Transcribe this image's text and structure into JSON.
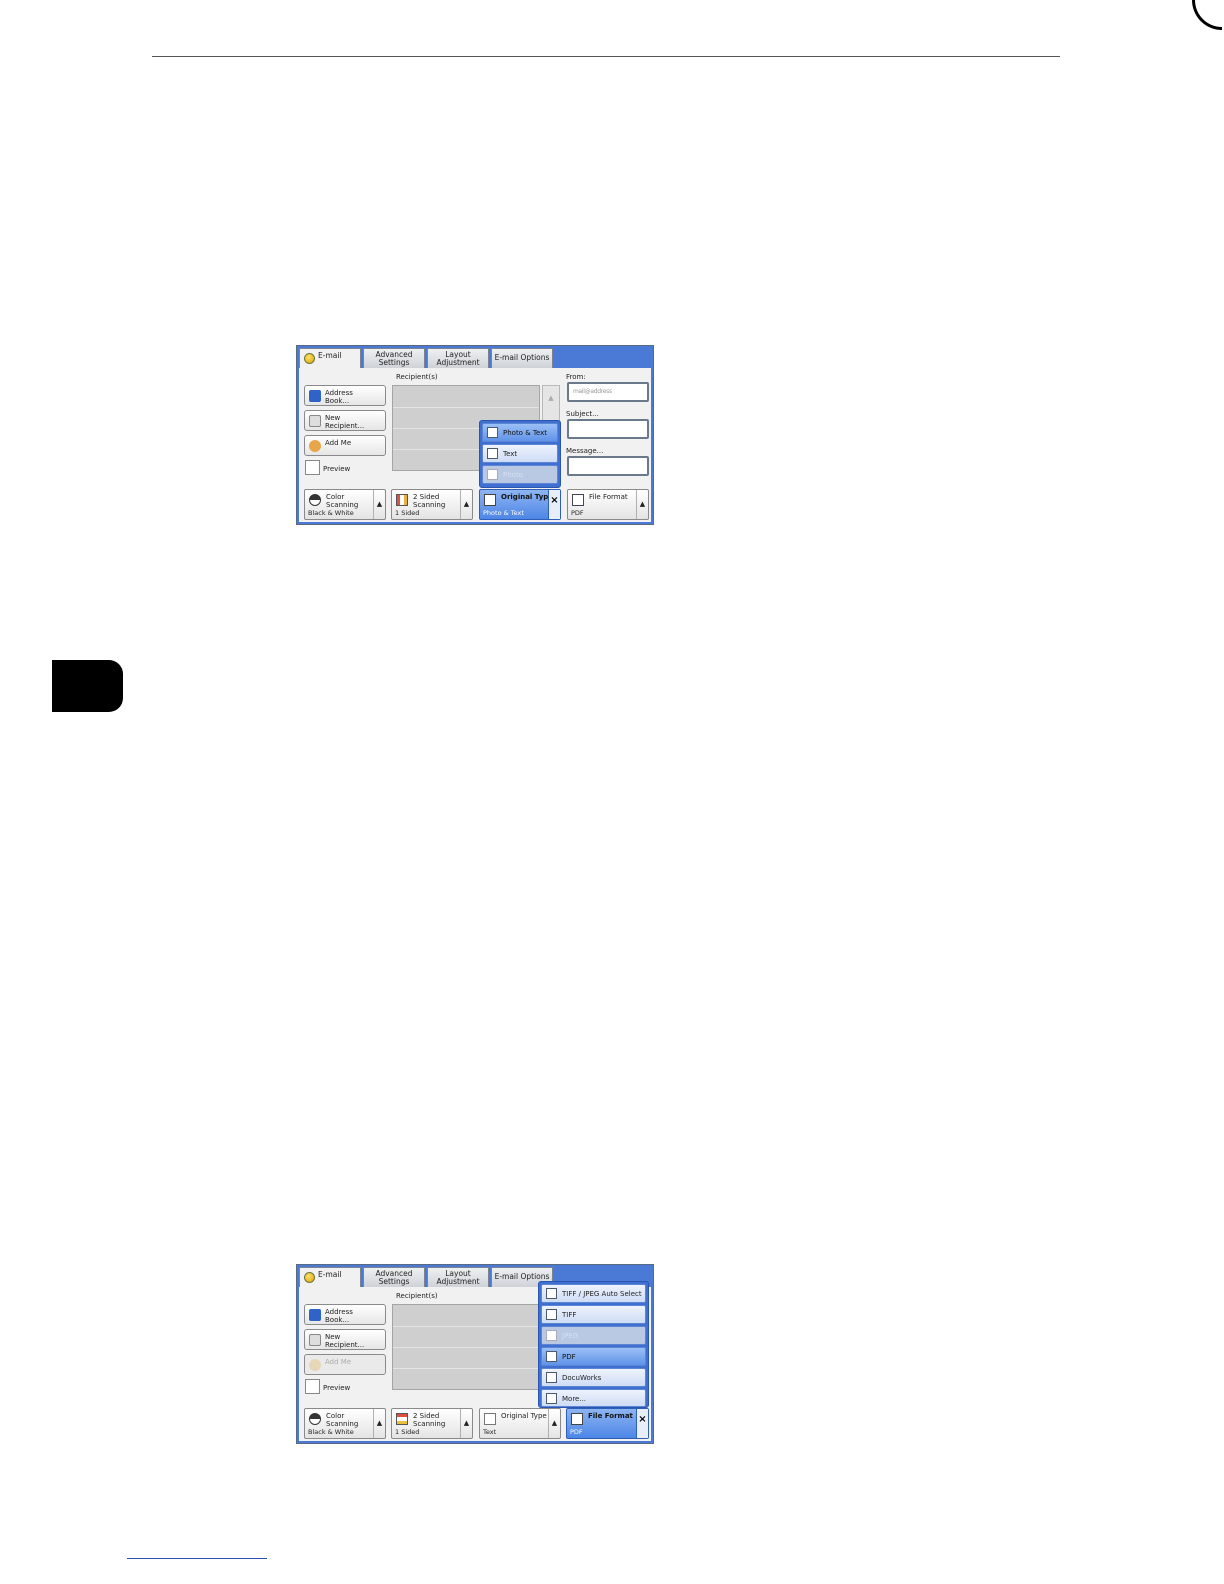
{
  "screens": [
    {
      "tabs": [
        "E-mail",
        "Advanced Settings",
        "Layout Adjustment",
        "E-mail Options"
      ],
      "recipients_label": "Recipient(s)",
      "left_buttons": {
        "address_book": "Address Book...",
        "new_recipient": "New Recipient...",
        "add_me": "Add Me",
        "preview": "Preview"
      },
      "fields": {
        "from_label": "From:",
        "from_value": "mail@address",
        "subject_label": "Subject...",
        "message_label": "Message..."
      },
      "features": {
        "color_scanning": {
          "title": "Color Scanning",
          "value": "Black & White"
        },
        "two_sided": {
          "title": "2 Sided Scanning",
          "value": "1 Sided"
        },
        "original_type": {
          "title": "Original Type",
          "value": "Photo & Text"
        },
        "file_format": {
          "title": "File Format",
          "value": "PDF"
        }
      },
      "close_symbol": "×",
      "up_arrow": "▲",
      "dropdown": [
        "Photo & Text",
        "Text",
        "Photo"
      ],
      "dropdown_selected": "Photo & Text"
    },
    {
      "tabs": [
        "E-mail",
        "Advanced Settings",
        "Layout Adjustment",
        "E-mail Options"
      ],
      "recipients_label": "Recipient(s)",
      "left_buttons": {
        "address_book": "Address Book...",
        "new_recipient": "New Recipient...",
        "add_me": "Add Me",
        "preview": "Preview"
      },
      "features": {
        "color_scanning": {
          "title": "Color Scanning",
          "value": "Black & White"
        },
        "two_sided": {
          "title": "2 Sided Scanning",
          "value": "1 Sided"
        },
        "original_type": {
          "title": "Original Type",
          "value": "Text"
        },
        "file_format": {
          "title": "File Format",
          "value": "PDF"
        }
      },
      "close_symbol": "×",
      "up_arrow": "▲",
      "dropdown": [
        "TIFF / JPEG Auto Select",
        "TIFF",
        "JPEG",
        "PDF",
        "DocuWorks",
        "More..."
      ],
      "dropdown_selected": "PDF"
    }
  ]
}
